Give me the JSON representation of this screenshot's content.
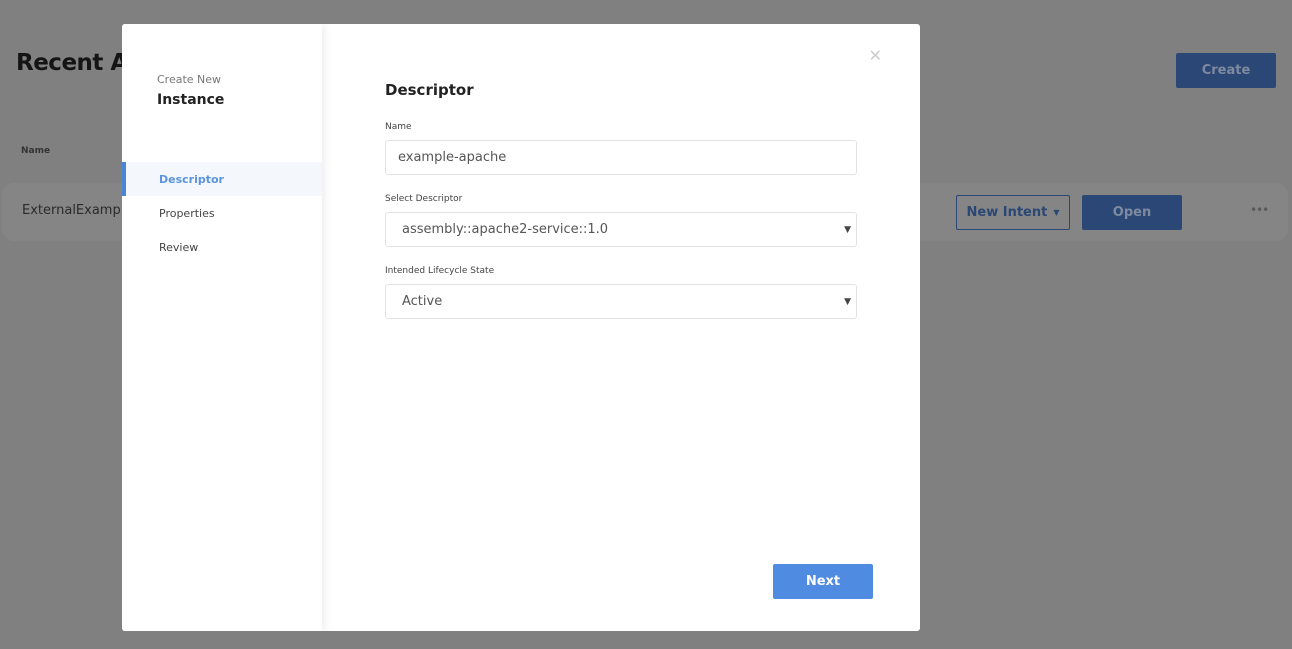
{
  "background": {
    "title": "Recent Assemblies",
    "create_label": "Create",
    "column_name": "Name",
    "row": {
      "name": "ExternalExample",
      "new_intent_label": "New Intent",
      "open_label": "Open",
      "more_icon": "more-horizontal-icon"
    }
  },
  "modal": {
    "subtitle": "Create New",
    "title": "Instance",
    "nav": [
      {
        "label": "Descriptor",
        "active": true
      },
      {
        "label": "Properties",
        "active": false
      },
      {
        "label": "Review",
        "active": false
      }
    ],
    "heading": "Descriptor",
    "name_label": "Name",
    "name_value": "example-apache",
    "descriptor_label": "Select Descriptor",
    "descriptor_value": "assembly::apache2-service::1.0",
    "lifecycle_label": "Intended Lifecycle State",
    "lifecycle_value": "Active",
    "next_label": "Next",
    "close_icon": "close-icon"
  },
  "colors": {
    "accent": "#4f8be0",
    "overlay": "#808080"
  }
}
